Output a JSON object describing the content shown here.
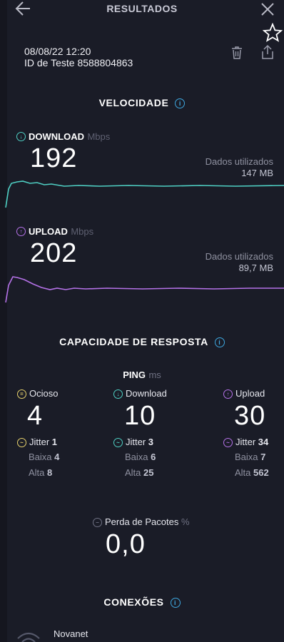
{
  "header": {
    "title": "RESULTADOS"
  },
  "test": {
    "date": "08/08/22 12:20",
    "id_label": "ID de Teste 8588804863"
  },
  "speed": {
    "title": "VELOCIDADE",
    "download": {
      "label": "DOWNLOAD",
      "unit": "Mbps",
      "value": "192",
      "data_label": "Dados utilizados",
      "data_value": "147 MB",
      "color": "#4fd0c4"
    },
    "upload": {
      "label": "UPLOAD",
      "unit": "Mbps",
      "value": "202",
      "data_label": "Dados utilizados",
      "data_value": "89,7 MB",
      "color": "#b572e8"
    }
  },
  "responsiveness": {
    "title": "CAPACIDADE DE RESPOSTA",
    "ping_label": "PING",
    "ping_unit": "ms",
    "columns": [
      {
        "label": "Ocioso",
        "value": "4",
        "jitter_label": "Jitter",
        "jitter": "1",
        "low_label": "Baixa",
        "low": "4",
        "high_label": "Alta",
        "high": "8"
      },
      {
        "label": "Download",
        "value": "10",
        "jitter_label": "Jitter",
        "jitter": "3",
        "low_label": "Baixa",
        "low": "6",
        "high_label": "Alta",
        "high": "25"
      },
      {
        "label": "Upload",
        "value": "30",
        "jitter_label": "Jitter",
        "jitter": "34",
        "low_label": "Baixa",
        "low": "7",
        "high_label": "Alta",
        "high": "562"
      }
    ],
    "packet_loss": {
      "label": "Perda de Pacotes",
      "unit": "%",
      "value": "0,0"
    }
  },
  "connections": {
    "title": "CONEXÕES",
    "provider": "Novanet"
  }
}
